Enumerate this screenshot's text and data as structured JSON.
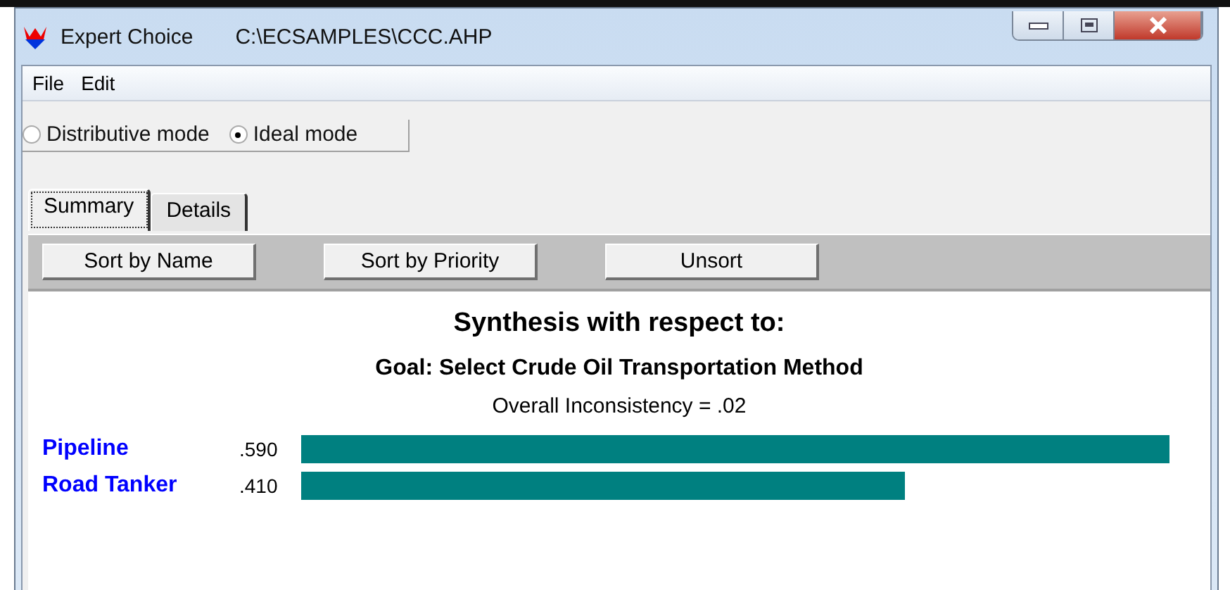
{
  "window": {
    "title": "Expert Choice",
    "file_path": "C:\\ECSAMPLES\\CCC.AHP"
  },
  "menu": [
    "File",
    "Edit"
  ],
  "modes": [
    {
      "label": "Distributive mode",
      "selected": false
    },
    {
      "label": "Ideal mode",
      "selected": true
    }
  ],
  "tabs": [
    {
      "label": "Summary",
      "selected": true
    },
    {
      "label": "Details",
      "selected": false
    }
  ],
  "toolbar": [
    "Sort by Name",
    "Sort by Priority",
    "Unsort"
  ],
  "synthesis": {
    "heading": "Synthesis with respect to:",
    "goal": "Goal: Select Crude Oil Transportation Method",
    "inconsistency": "Overall Inconsistency = .02",
    "rows": [
      {
        "name": "Pipeline",
        "value": ".590",
        "level": 1
      },
      {
        "name": "Road Tanker",
        "value": ".410",
        "level": 0.695
      }
    ]
  }
}
